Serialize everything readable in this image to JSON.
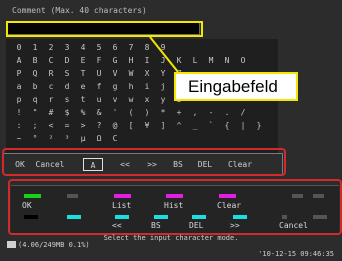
{
  "dialog": {
    "title": "Comment (Max. 40 characters)",
    "input_value": ""
  },
  "char_grid": {
    "rows": [
      [
        "0",
        "1",
        "2",
        "3",
        "4",
        "5",
        "6",
        "7",
        "8",
        "9",
        "",
        "",
        "",
        "",
        "",
        "",
        ""
      ],
      [
        "A",
        "B",
        "C",
        "D",
        "E",
        "F",
        "G",
        "H",
        "I",
        "J",
        "K",
        "L",
        "M",
        "N",
        "O",
        "",
        ""
      ],
      [
        "P",
        "Q",
        "R",
        "S",
        "T",
        "U",
        "V",
        "W",
        "X",
        "Y",
        "Z",
        "",
        "",
        "",
        "",
        "",
        ""
      ],
      [
        "a",
        "b",
        "c",
        "d",
        "e",
        "f",
        "g",
        "h",
        "i",
        "j",
        "k",
        "",
        "",
        "",
        "",
        "",
        ""
      ],
      [
        "p",
        "q",
        "r",
        "s",
        "t",
        "u",
        "v",
        "w",
        "x",
        "y",
        "z",
        "",
        "",
        "",
        "",
        "",
        ""
      ],
      [
        "!",
        "\"",
        "#",
        "$",
        "%",
        "&",
        "'",
        "(",
        ")",
        "*",
        "+",
        ",",
        "-",
        ".",
        "/",
        "",
        ""
      ],
      [
        ":",
        ";",
        "<",
        "=",
        ">",
        "?",
        "@",
        "[",
        "¥",
        "]",
        "^",
        "_",
        "`",
        "{",
        "|",
        "}",
        ""
      ],
      [
        "~",
        "°",
        "²",
        "³",
        "µ",
        "Ω",
        "C",
        "",
        "",
        " ",
        "",
        "",
        "",
        "",
        "",
        "",
        ""
      ]
    ]
  },
  "modes": {
    "items": [
      {
        "label": "OK"
      },
      {
        "label": "Cancel"
      },
      {
        "label": "A"
      },
      {
        "label": "<<"
      },
      {
        "label": ">>"
      },
      {
        "label": "BS"
      },
      {
        "label": "DEL"
      },
      {
        "label": "Clear"
      }
    ],
    "selected_index": 2
  },
  "fkeys": {
    "top": [
      {
        "label": "OK",
        "color": "#19d119"
      },
      {
        "label": "",
        "color": "#555555"
      },
      {
        "label": "List",
        "color": "#e21ee2"
      },
      {
        "label": "Hist",
        "color": "#e21ee2"
      },
      {
        "label": "Clear",
        "color": "#e21ee2"
      },
      {
        "label": "",
        "color": "#555555"
      },
      {
        "label": "",
        "color": "#555555"
      }
    ],
    "bottom": [
      {
        "label": "",
        "color": "#000000"
      },
      {
        "label": "",
        "color": "#19e0e0"
      },
      {
        "label": "<<",
        "color": "#19e0e0"
      },
      {
        "label": "BS",
        "color": "#19e0e0"
      },
      {
        "label": "DEL",
        "color": "#19e0e0"
      },
      {
        "label": ">>",
        "color": "#19e0e0"
      },
      {
        "label": "Cancel",
        "color": "#555555"
      },
      {
        "label": "",
        "color": "#555555"
      }
    ]
  },
  "status": {
    "help": "Select the input character mode.",
    "drive": "(4.06/249MB 0.1%)",
    "datetime": "'10-12-15 09:46:35"
  },
  "callout": {
    "label": "Eingabefeld",
    "color": "#f3e600"
  },
  "highlight_color": "#d12a2a"
}
